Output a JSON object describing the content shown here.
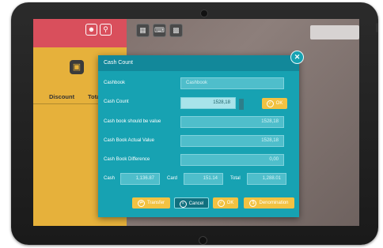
{
  "left_panel": {
    "user_icon": "user-icon",
    "search_icon": "search-icon",
    "panel_icon": "register-icon",
    "col_discount": "Discount",
    "col_total": "Total"
  },
  "toolbar": {
    "icons": [
      "clipboard-icon",
      "keyboard-icon",
      "database-icon"
    ]
  },
  "dialog": {
    "title": "Cash Count",
    "fields": {
      "cashbook_label": "Cashbook",
      "cashbook_placeholder": "Cashbook",
      "cash_count_label": "Cash Count",
      "cash_count_value": "1528,18",
      "should_be_label": "Cash book should be value",
      "should_be_value": "1528,18",
      "actual_label": "Cash Book Actual Value",
      "actual_value": "1528,18",
      "difference_label": "Cash Book Difference",
      "difference_value": "0,00"
    },
    "totals": {
      "cash_label": "Cash",
      "cash_value": "1,136.87",
      "card_label": "Card",
      "card_value": "151.14",
      "total_label": "Total",
      "total_value": "1,288.01"
    },
    "buttons": {
      "ok_inline": "OK",
      "transfer": "Transfer",
      "cancel": "Cancel",
      "ok": "OK",
      "denomination": "Denomination"
    }
  },
  "colors": {
    "dialog": "#17a2b2",
    "dialog_header": "#12889a",
    "accent_yellow": "#f2c242",
    "left_red": "#d94f5c",
    "left_yellow": "#e6b13b"
  }
}
